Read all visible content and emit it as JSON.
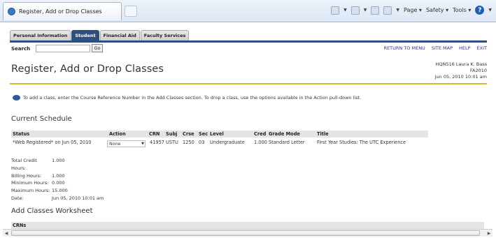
{
  "browser": {
    "tab_title": "Register, Add or Drop Classes",
    "menu": {
      "page": "Page",
      "safety": "Safety",
      "tools": "Tools"
    }
  },
  "nav": {
    "tabs": [
      "Personal Information",
      "Student",
      "Financial Aid",
      "Faculty Services"
    ],
    "active_tab": "Student",
    "search_label": "Search",
    "go_label": "Go",
    "links": [
      "RETURN TO MENU",
      "SITE MAP",
      "HELP",
      "EXIT"
    ]
  },
  "header": {
    "title": "Register, Add or Drop Classes",
    "user_line": "HQN516 Laura K. Bass",
    "term": "FA2010",
    "timestamp": "Jun 05, 2010 10:01 am"
  },
  "info_text": "To add a class, enter the Course Reference Number in the Add Classes section. To drop a class, use the options available in the Action pull-down list.",
  "current_schedule": {
    "heading": "Current Schedule",
    "columns": [
      "Status",
      "Action",
      "CRN",
      "Subj",
      "Crse",
      "Sec",
      "Level",
      "Cred",
      "Grade Mode",
      "Title"
    ],
    "rows": [
      {
        "status": "*Web Registered* on Jun 05, 2010",
        "action": "None",
        "crn": "41957",
        "subj": "USTU",
        "crse": "1250",
        "sec": "03",
        "level": "Undergraduate",
        "cred": "1.000",
        "grade_mode": "Standard Letter",
        "title": "First Year Studies: The UTC Experience"
      }
    ]
  },
  "totals": {
    "total_credit": {
      "label": "Total Credit Hours:",
      "value": "1.000"
    },
    "billing": {
      "label": "Billing Hours:",
      "value": "1.000"
    },
    "minimum": {
      "label": "Minimum Hours:",
      "value": "0.000"
    },
    "maximum": {
      "label": "Maximum Hours:",
      "value": "15.000"
    },
    "date": {
      "label": "Date:",
      "value": "Jun 05, 2010 10:01 am"
    }
  },
  "add_worksheet": {
    "heading": "Add Classes Worksheet",
    "crns_label": "CRNs"
  }
}
